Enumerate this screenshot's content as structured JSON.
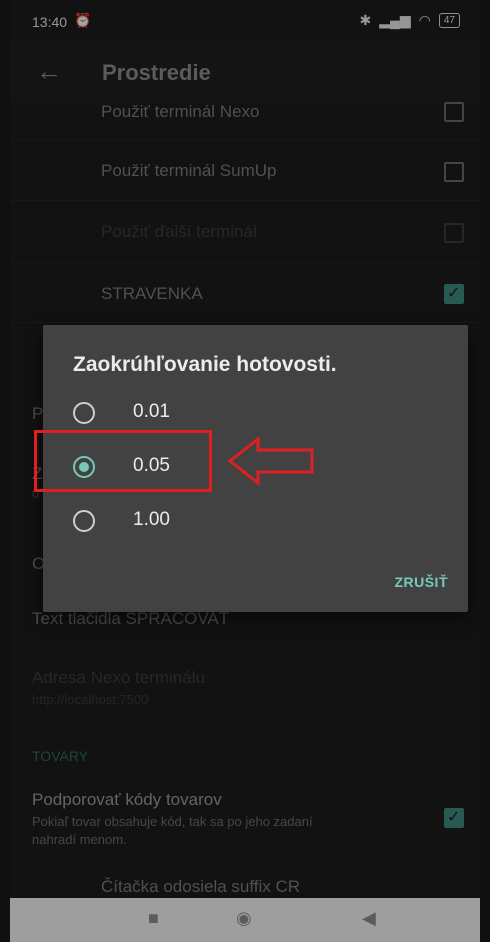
{
  "status": {
    "time": "13:40",
    "battery": "47"
  },
  "appbar": {
    "title": "Prostredie"
  },
  "settings": {
    "rows": [
      {
        "label": "Použiť terminál Nexo",
        "checked": false,
        "enabled": true
      },
      {
        "label": "Použiť terminál SumUp",
        "checked": false,
        "enabled": true
      },
      {
        "label": "Použiť ďalší terminál",
        "checked": false,
        "enabled": false
      },
      {
        "label": "STRAVENKA",
        "checked": true,
        "enabled": true
      }
    ],
    "peek_p": "P",
    "peek_z": "Z",
    "peek_0": "0",
    "peek_o": "O",
    "text_button": "Text tlačidla SPRACOVAŤ",
    "nexo_address_label": "Adresa Nexo terminálu",
    "nexo_address_value": "http://localhost:7500",
    "section_tovary": "TOVARY",
    "product_codes_title": "Podporovať kódy tovarov",
    "product_codes_desc_1": "Pokiaľ tovar obsahuje kód, tak sa po jeho zadaní",
    "product_codes_desc_2": "nahradí menom.",
    "partial_row": "Čítačka odosiela suffix CR"
  },
  "dialog": {
    "title": "Zaokrúhľovanie hotovosti.",
    "options": [
      "0.01",
      "0.05",
      "1.00"
    ],
    "selected_index": 1,
    "cancel": "ZRUŠIŤ"
  },
  "colors": {
    "accent": "#79c9bb",
    "annotation": "#e02020",
    "background": "#1c1c1c"
  }
}
